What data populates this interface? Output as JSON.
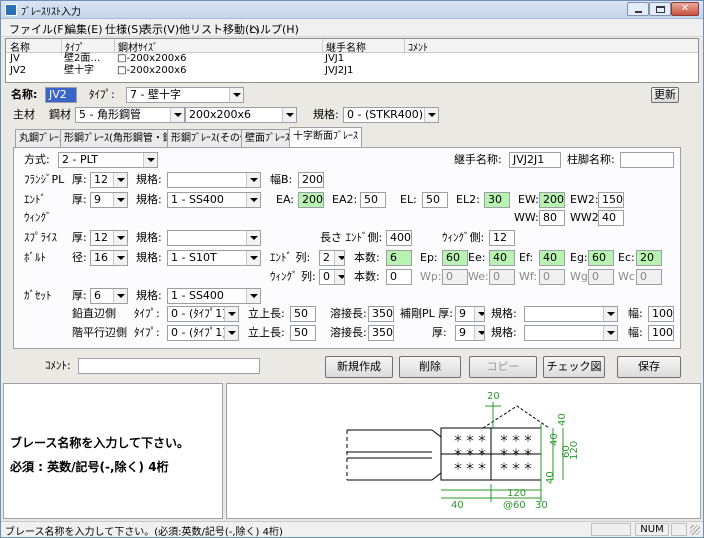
{
  "window": {
    "title": "ﾌﾞﾚｰｽﾘｽﾄ入力"
  },
  "menu": [
    "ファイル(F)",
    "編集(E)",
    "仕様(S)",
    "表示(V)",
    "他リスト移動(L)",
    "ヘルプ(H)"
  ],
  "list": {
    "headers": [
      "名称",
      "ﾀｲﾌﾟ",
      "鋼材ｻｲｽﾞ",
      "継手名称",
      "ｺﾒﾝﾄ"
    ],
    "rows": [
      [
        "JV",
        "壁2面…",
        "□-200x200x6",
        "JVJ1",
        ""
      ],
      [
        "JV2",
        "壁十字",
        "□-200x200x6",
        "JVJ2J1",
        ""
      ]
    ]
  },
  "header": {
    "name_label": "名称:",
    "name_value": "JV2",
    "type_label": "ﾀｲﾌﾟ:",
    "type_value": "7 - 壁十字",
    "update_button": "更新",
    "main_label": "主材",
    "steel_label": "鋼材",
    "steel_value": "5 - 角形鋼管",
    "size_value": "200x200x6",
    "spec_label": "規格:",
    "spec_value": "0 - (STKR400)"
  },
  "tabs": [
    "丸鋼ﾌﾞﾚｰｽ",
    "形鋼ﾌﾞﾚｰｽ(角形鋼管・鋼管)",
    "形鋼ﾌﾞﾚｰｽ(その他)",
    "壁面ﾌﾞﾚｰｽ",
    "十字断面ﾌﾞﾚｰｽ"
  ],
  "form": {
    "method_label": "方式:",
    "method_value": "2 - PLT",
    "joint_name_label": "継手名称:",
    "joint_name_value": "JVJ2J1",
    "column_label": "柱脚名称:",
    "column_value": "",
    "flange_label": "ﾌﾗﾝｼﾞPL",
    "thick_label": "厚:",
    "flange_thick": "12",
    "spec_label": "規格:",
    "flange_spec": "",
    "width_b_label": "幅B:",
    "width_b_value": "200",
    "end_label": "ｴﾝﾄﾞ",
    "end_thick": "9",
    "end_spec": "1 - SS400",
    "ea_label": "EA:",
    "ea_value": "200",
    "ea2_label": "EA2:",
    "ea2_value": "50",
    "el_label": "EL:",
    "el_value": "50",
    "el2_label": "EL2:",
    "el2_value": "30",
    "ew_label": "EW:",
    "ew_value": "200",
    "ew2_label": "EW2:",
    "ew2_value": "150",
    "wing_label": "ｳｨﾝｸﾞ",
    "ww_label": "WW:",
    "ww_value": "80",
    "ww2_label": "WW2:",
    "ww2_value": "40",
    "splice_label": "ｽﾌﾟﾗｲｽ",
    "splice_thick": "12",
    "splice_spec": "",
    "length_label": "長さ ｴﾝﾄﾞ側:",
    "length_end": "400",
    "wing_side_label": "ｳｨﾝｸﾞ側:",
    "length_wing": "12",
    "bolt_label": "ﾎﾞﾙﾄ",
    "dia_label": "径:",
    "bolt_dia": "16",
    "bolt_spec": "1 - S10T",
    "end_row_label": "ｴﾝﾄﾞ 列:",
    "end_rows": "2",
    "count_label": "本数:",
    "end_count": "6",
    "ep_label": "Ep:",
    "ep_value": "60",
    "ee_label": "Ee:",
    "ee_value": "40",
    "ef_label": "Ef:",
    "ef_value": "40",
    "eg_label": "Eg:",
    "eg_value": "60",
    "ec_label": "Ec:",
    "ec_value": "20",
    "wing_row_label": "ｳｨﾝｸﾞ 列:",
    "wing_rows": "0",
    "wing_count": "0",
    "wp_label": "Wp:",
    "wp_value": "0",
    "we_label": "We:",
    "we_value": "0",
    "wf_label": "Wf:",
    "wf_value": "0",
    "wg_label": "Wg:",
    "wg_value": "0",
    "wc_label": "Wc:",
    "wc_value": "0",
    "gusset_label": "ｶﾞｾｯﾄ",
    "gusset_thick": "6",
    "gusset_spec": "1 - SS400",
    "vertical_label": "鉛直辺側",
    "type_label": "ﾀｲﾌﾟ:",
    "vertical_type": "0 - (ﾀｲﾌﾟ1)",
    "rise_label": "立上長:",
    "vertical_rise": "50",
    "weld_label": "溶接長:",
    "vertical_weld": "350",
    "stiff_label": "補剛PL 厚:",
    "stiff_thick1": "9",
    "stiff_spec1": "",
    "width_label": "幅:",
    "stiff_width1": "100",
    "horizontal_label": "階平行辺側",
    "horizontal_type": "0 - (ﾀｲﾌﾟ1)",
    "horizontal_rise": "50",
    "horizontal_weld": "350",
    "stiff_thick2": "9",
    "stiff_spec2": "",
    "stiff_width2": "100"
  },
  "comment": {
    "label": "ｺﾒﾝﾄ:",
    "value": ""
  },
  "buttons": {
    "new": "新規作成",
    "delete": "削除",
    "copy": "コピー",
    "check": "チェック図",
    "save": "保存"
  },
  "message": {
    "line1": "ブレース名称を入力して下さい。",
    "line2": "必須 : 英数/記号(-,除く) 4桁"
  },
  "drawing": {
    "dims": [
      "20",
      "40",
      "40",
      "60",
      "120",
      "40",
      "40",
      "120",
      "@60",
      "30"
    ]
  },
  "status": {
    "text": "ブレース名称を入力して下さい。(必須:英数/記号(-,除く) 4桁)",
    "num": "NUM"
  }
}
